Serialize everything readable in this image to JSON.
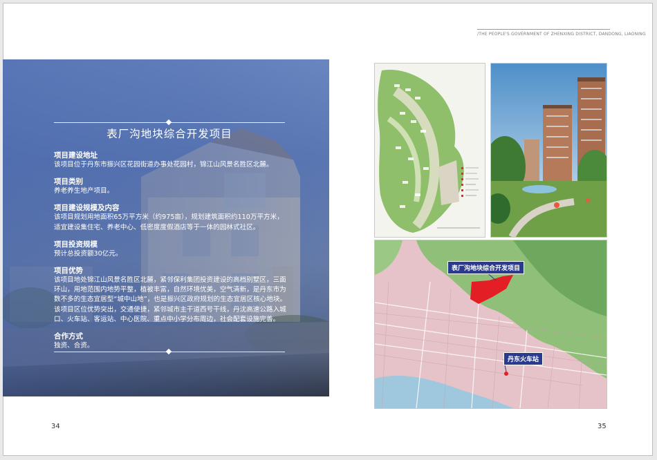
{
  "header": {
    "text": "/THE PEOPLE'S GOVERNMENT OF ZHENXING DISTRICT, DANDONG, LIAONING"
  },
  "project": {
    "title": "表厂沟地块综合开发项目",
    "sections": [
      {
        "heading": "项目建设地址",
        "body": "该项目位于丹东市振兴区花园街道办事处花园村，锦江山风景名胜区北麓。"
      },
      {
        "heading": "项目类别",
        "body": "养老养生地产项目。"
      },
      {
        "heading": "项目建设规模及内容",
        "body": "该项目规划用地面积65万平方米（约975亩），规划建筑面积约110万平方米，适宜建设集住宅、养老中心、低密度度假酒店等于一体的园林式社区。"
      },
      {
        "heading": "项目投资规模",
        "body": "预计总投资额30亿元。"
      },
      {
        "heading": "项目优势",
        "body": "该项目地处锦江山风景名胜区北麓，紧邻保利集团投资建设的高档别墅区，三面环山，用地范围内地势平整，植被丰富，自然环境优美，空气清新，是丹东市为数不多的生态宜居型“城中山地”，也是振兴区政府规划的生态宜居区核心地块。该项目区位优势突出，交通便捷，紧邻城市主干道西号干线，丹沈高速公路入城口、火车站、客运站、中心医院、重点中小学分布周边，社会配套设施完善。"
      },
      {
        "heading": "合作方式",
        "body": "独资、合资。"
      }
    ]
  },
  "map": {
    "project_label": "表厂沟地块综合开发项目",
    "station_label": "丹东火车站"
  },
  "pages": {
    "left": "34",
    "right": "35"
  },
  "colors": {
    "panel_blue": "#5d79b3",
    "label_navy": "#2a3a8c",
    "site_red": "#e31e24"
  }
}
